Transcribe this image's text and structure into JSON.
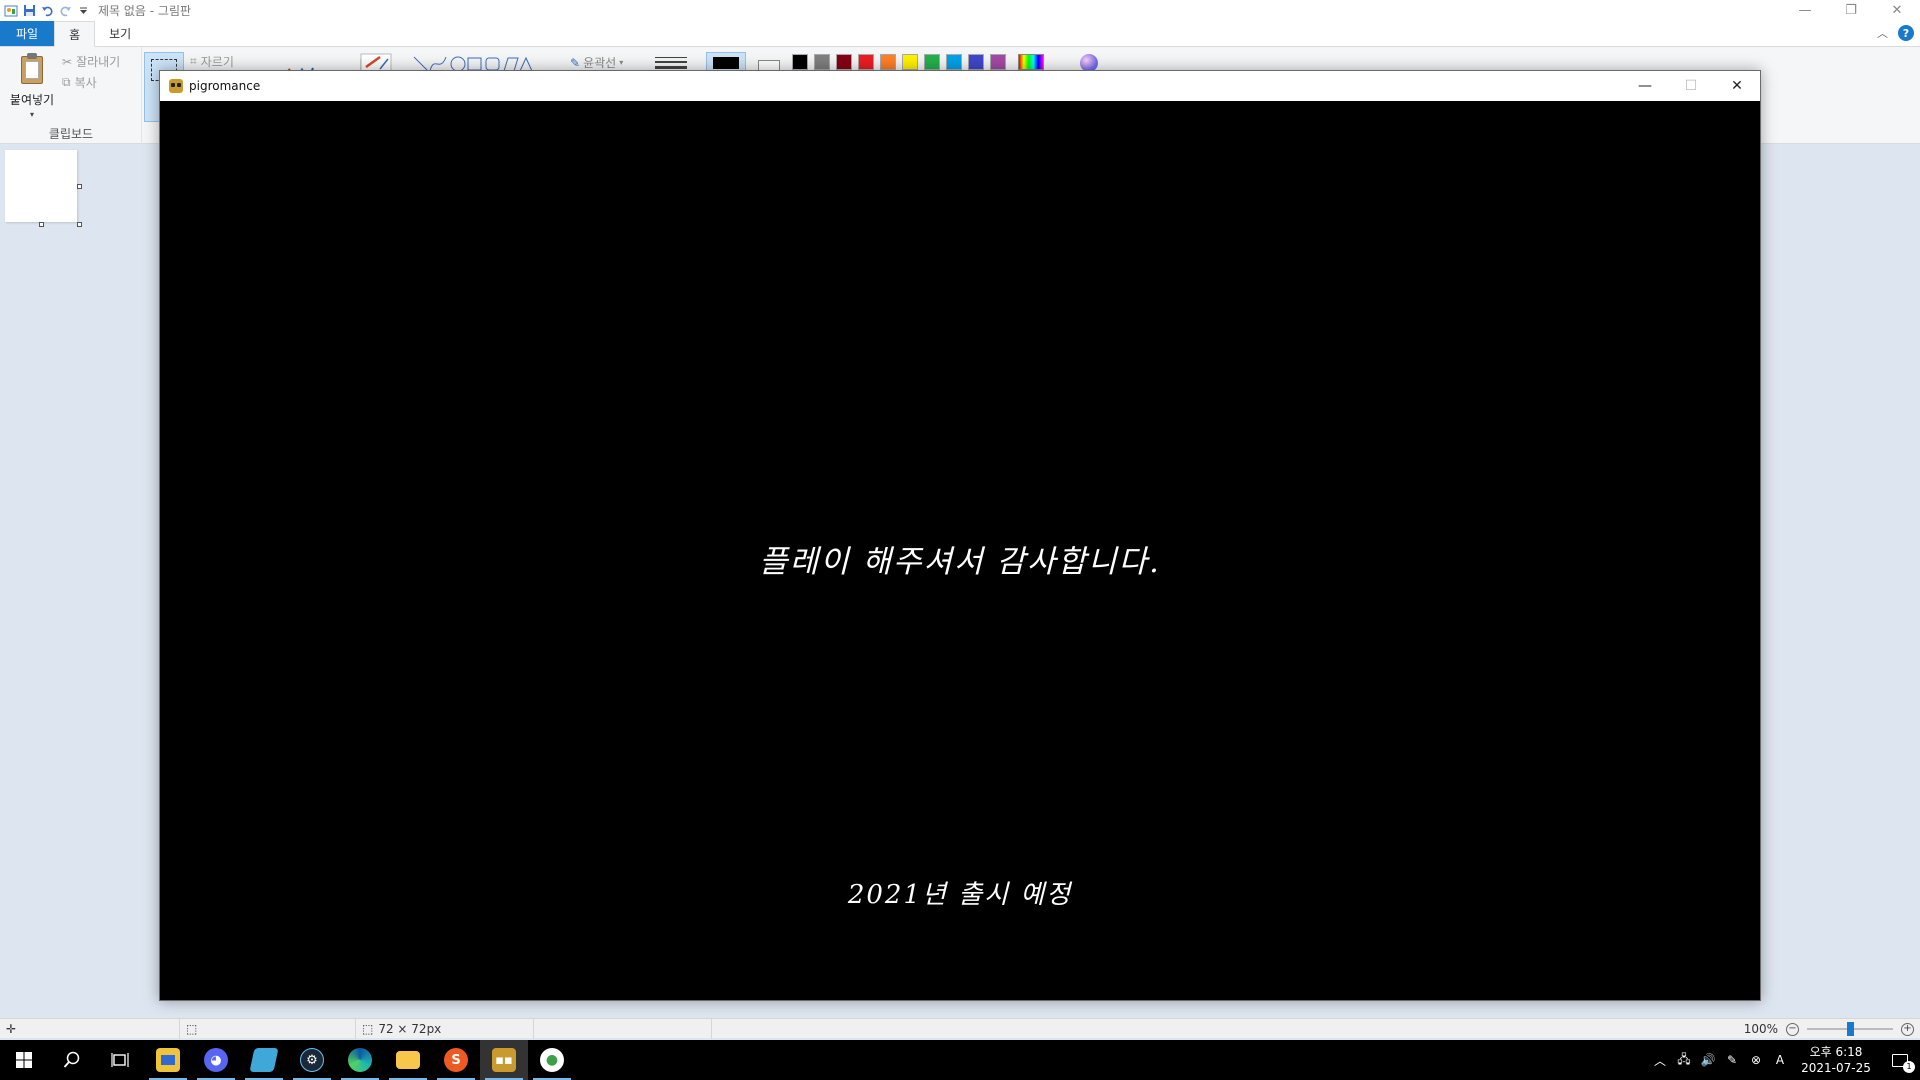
{
  "paint": {
    "window_title": "제목 없음 - 그림판",
    "tabs": [
      {
        "label": "파일"
      },
      {
        "label": "홈"
      },
      {
        "label": "보기"
      }
    ],
    "clipboard": {
      "paste_label": "붙여넣기",
      "cut_label": "잘라내기",
      "copy_label": "복사",
      "group_label": "클립보드"
    },
    "image": {
      "crop_label": "자르기"
    },
    "shapes": {
      "outline_label": "윤곽선"
    },
    "colors": {
      "color1": "#000000",
      "color2": "#ffffff",
      "palette": [
        "#000000",
        "#7f7f7f",
        "#880015",
        "#ed1c24",
        "#ff7f27",
        "#fff200",
        "#22b14c",
        "#00a2e8",
        "#3f48cc",
        "#a349a4"
      ]
    },
    "status": {
      "canvas_size": "72 × 72px",
      "zoom": "100%"
    }
  },
  "game": {
    "window_title": "pigromance",
    "message": "플레이 해주셔서 감사합니다.",
    "release_note": "2021년 출시 예정"
  },
  "taskbar": {
    "apps": [
      "file-manager",
      "discord",
      "notepad",
      "steam",
      "edge",
      "explorer",
      "s-app",
      "pigromance",
      "paint"
    ],
    "clock_time": "오후 6:18",
    "clock_date": "2021-07-25",
    "notification_count": "1",
    "ime_label": "A"
  }
}
